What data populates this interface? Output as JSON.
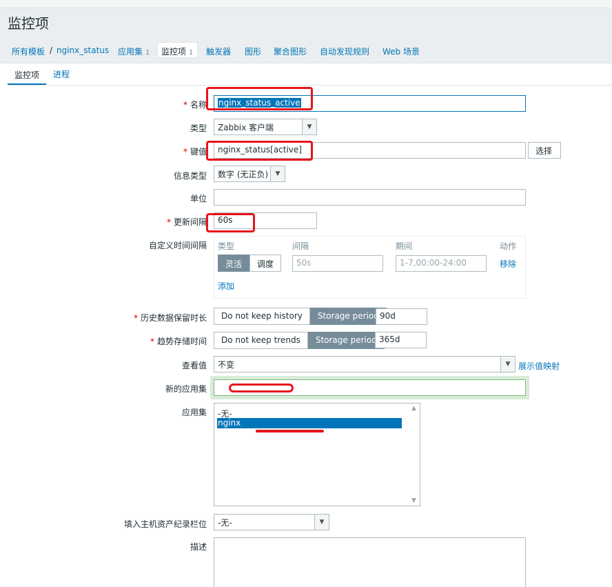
{
  "page": {
    "title": "监控项"
  },
  "nav": {
    "all_templates": "所有模板",
    "sep": "/",
    "template_name": "nginx_status",
    "applications": "应用集",
    "applications_count": "1",
    "items": "监控项",
    "items_count": "1",
    "triggers": "触发器",
    "graphs": "图形",
    "screens": "聚合图形",
    "discovery": "自动发现规则",
    "web": "Web 场景"
  },
  "tabs": {
    "item": "监控项",
    "preprocessing": "进程"
  },
  "form": {
    "name": {
      "label": "名称",
      "value": "nginx_status_active"
    },
    "type": {
      "label": "类型",
      "value": "Zabbix 客户端"
    },
    "key": {
      "label": "键值",
      "value": "nginx_status[active]",
      "button": "选择"
    },
    "info_type": {
      "label": "信息类型",
      "value": "数字 (无正负)"
    },
    "units": {
      "label": "单位",
      "value": ""
    },
    "interval": {
      "label": "更新间隔",
      "value": "60s"
    },
    "custom_intervals": {
      "label": "自定义时间间隔",
      "col_type": "类型",
      "col_interval": "间隔",
      "col_period": "期间",
      "col_action": "动作",
      "flexible": "灵活",
      "scheduling": "调度",
      "interval_placeholder": "50s",
      "period_placeholder": "1-7,00:00-24:00",
      "remove": "移除",
      "add": "添加"
    },
    "history": {
      "label": "历史数据保留时长",
      "opt1": "Do not keep history",
      "opt2": "Storage period",
      "value": "90d"
    },
    "trends": {
      "label": "趋势存储时间",
      "opt1": "Do not keep trends",
      "opt2": "Storage period",
      "value": "365d"
    },
    "valuemap": {
      "label": "查看值",
      "value": "不变",
      "link": "展示值映射"
    },
    "new_application": {
      "label": "新的应用集",
      "value": ""
    },
    "applications": {
      "label": "应用集",
      "options": [
        "-无-",
        "nginx"
      ],
      "selected": "nginx"
    },
    "inventory": {
      "label": "填入主机资产纪录栏位",
      "value": "-无-"
    },
    "description": {
      "label": "描述",
      "value": ""
    }
  },
  "colors": {
    "link": "#0275b8",
    "required": "#d40000",
    "annotation": "#e8141b",
    "selected": "#0275b8"
  }
}
